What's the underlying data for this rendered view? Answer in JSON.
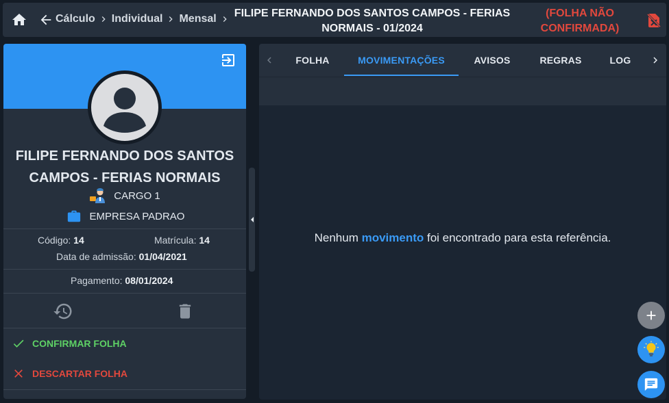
{
  "header": {
    "breadcrumbs": [
      "Cálculo",
      "Individual",
      "Mensal"
    ],
    "title": "FILIPE FERNANDO DOS SANTOS CAMPOS - FERIAS NORMAIS - 01/2024",
    "status": "(FOLHA NÃO CONFIRMADA)"
  },
  "employee": {
    "name": "FILIPE FERNANDO DOS SANTOS CAMPOS - FERIAS NORMAIS",
    "cargo": "CARGO 1",
    "empresa": "EMPRESA PADRAO",
    "codigo_label": "Código:",
    "codigo": "14",
    "matricula_label": "Matrícula:",
    "matricula": "14",
    "admissao_label": "Data de admissão:",
    "admissao": "01/04/2021",
    "pagamento_label": "Pagamento:",
    "pagamento": "08/01/2024"
  },
  "actions": {
    "confirm_label": "CONFIRMAR FOLHA",
    "discard_label": "DESCARTAR FOLHA"
  },
  "tabs": [
    {
      "label": "FOLHA",
      "active": false
    },
    {
      "label": "MOVIMENTAÇÕES",
      "active": true
    },
    {
      "label": "AVISOS",
      "active": false
    },
    {
      "label": "REGRAS",
      "active": false
    },
    {
      "label": "LOG",
      "active": false
    }
  ],
  "content": {
    "empty_prefix": "Nenhum ",
    "empty_highlight": "movimento",
    "empty_suffix": " foi encontrado para esta referência."
  },
  "colors": {
    "accent": "#2d93f2",
    "danger": "#e2483d",
    "success": "#5ed165",
    "panel": "#26303d",
    "background": "#141c26"
  },
  "icons": {
    "home": "home-icon",
    "back": "arrow-left-icon",
    "status": "document-off-icon",
    "exit": "exit-icon",
    "restore": "restore-icon",
    "delete": "trash-icon",
    "add": "plus-icon",
    "tip": "lightbulb-icon",
    "chat": "chat-icon"
  }
}
